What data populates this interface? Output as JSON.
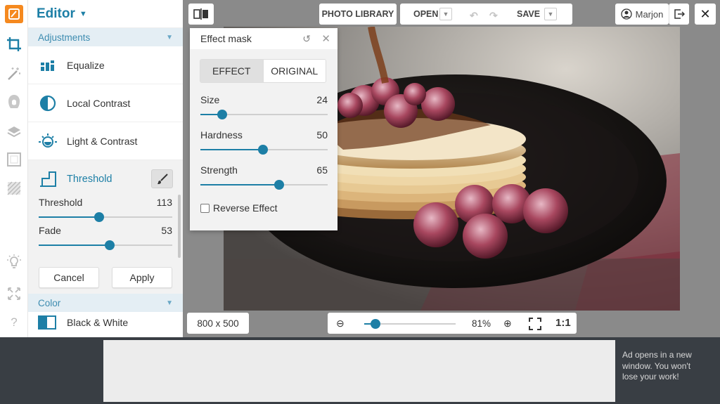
{
  "panel": {
    "title": "Editor",
    "sections": {
      "adjustments": "Adjustments",
      "color": "Color"
    },
    "tools": [
      "Equalize",
      "Local Contrast",
      "Light & Contrast"
    ],
    "threshold": {
      "title": "Threshold",
      "sliders": [
        {
          "label": "Threshold",
          "value": "113",
          "fraction": 0.45
        },
        {
          "label": "Fade",
          "value": "53",
          "fraction": 0.53
        }
      ],
      "cancel": "Cancel",
      "apply": "Apply"
    },
    "next_tool": "Black & White"
  },
  "toolbar": {
    "photo_library": "PHOTO LIBRARY",
    "open": "OPEN",
    "save": "SAVE",
    "user": "Marjon"
  },
  "mask": {
    "title": "Effect mask",
    "tabs": {
      "effect": "EFFECT",
      "original": "ORIGINAL"
    },
    "sliders": [
      {
        "label": "Size",
        "value": "24",
        "fraction": 0.17
      },
      {
        "label": "Hardness",
        "value": "50",
        "fraction": 0.49
      },
      {
        "label": "Strength",
        "value": "65",
        "fraction": 0.62
      }
    ],
    "reverse": "Reverse Effect"
  },
  "status": {
    "dimensions": "800 x 500",
    "zoom": "81%",
    "zoom_fraction": 0.12,
    "one_to_one": "1:1"
  },
  "ad": {
    "note": "Ad opens in a new window. You won't lose your work!"
  },
  "colors": {
    "accent": "#1d7fa6",
    "logo": "#f5891f",
    "section_bg": "#e4eef4"
  }
}
